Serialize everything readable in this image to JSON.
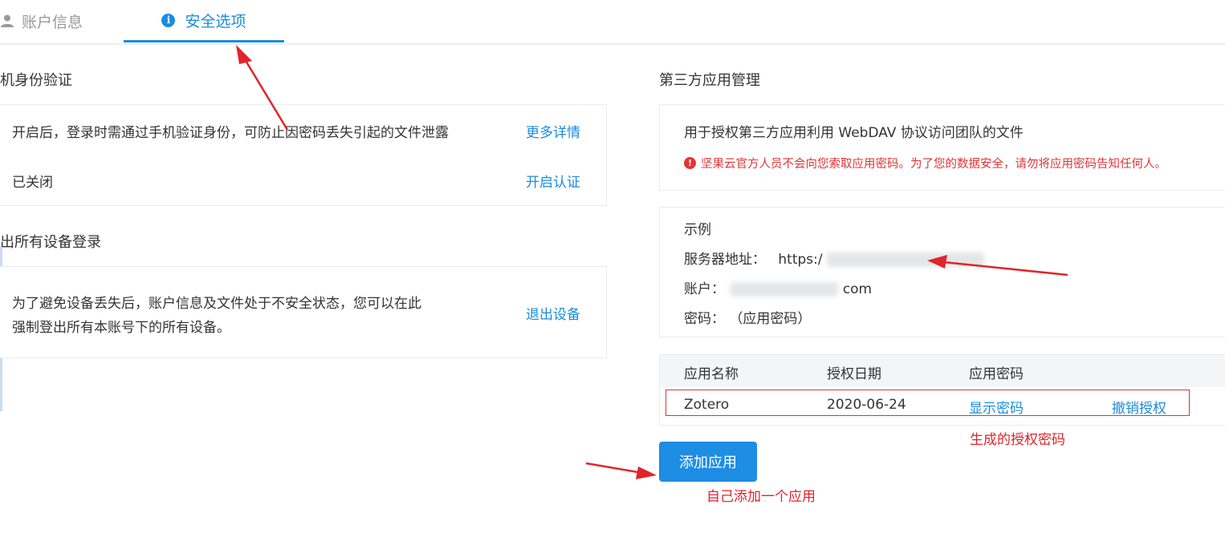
{
  "tabs": [
    {
      "label": "账户信息",
      "icon": "person-icon",
      "active": false
    },
    {
      "label": "安全选项",
      "icon": "info-icon",
      "active": true
    }
  ],
  "left": {
    "mfa": {
      "title": "机身份验证",
      "description": "开启后，登录时需通过手机验证身份，可防止因密码丢失引起的文件泄露",
      "more_link": "更多详情",
      "status": "已关闭",
      "enable_link": "开启认证"
    },
    "logout_all": {
      "title": "出所有设备登录",
      "description_line1": "为了避免设备丢失后，账户信息及文件处于不安全状态，您可以在此",
      "description_line2": "强制登出所有本账号下的所有设备。",
      "logout_link": "退出设备"
    }
  },
  "right": {
    "title": "第三方应用管理",
    "intro": "用于授权第三方应用利用 WebDAV 协议访问团队的文件",
    "warning": "坚果云官方人员不会向您索取应用密码。为了您的数据安全，请勿将应用密码告知任何人。",
    "example": {
      "title": "示例",
      "server_label": "服务器地址：",
      "server_value": "https:/",
      "account_label": "账户：",
      "account_suffix": "com",
      "password_label": "密码：",
      "password_value": "（应用密码）"
    },
    "table": {
      "headers": [
        "应用名称",
        "授权日期",
        "应用密码"
      ],
      "rows": [
        {
          "name": "Zotero",
          "date": "2020-06-24",
          "show_password": "显示密码",
          "revoke": "撤销授权"
        }
      ]
    },
    "add_button": "添加应用"
  },
  "annotations": {
    "generated_password_note": "生成的授权密码",
    "add_app_note": "自己添加一个应用"
  },
  "colors": {
    "accent": "#1a8cde",
    "warning": "#e23434",
    "annotation": "#e0252a",
    "button": "#1e8de4"
  }
}
